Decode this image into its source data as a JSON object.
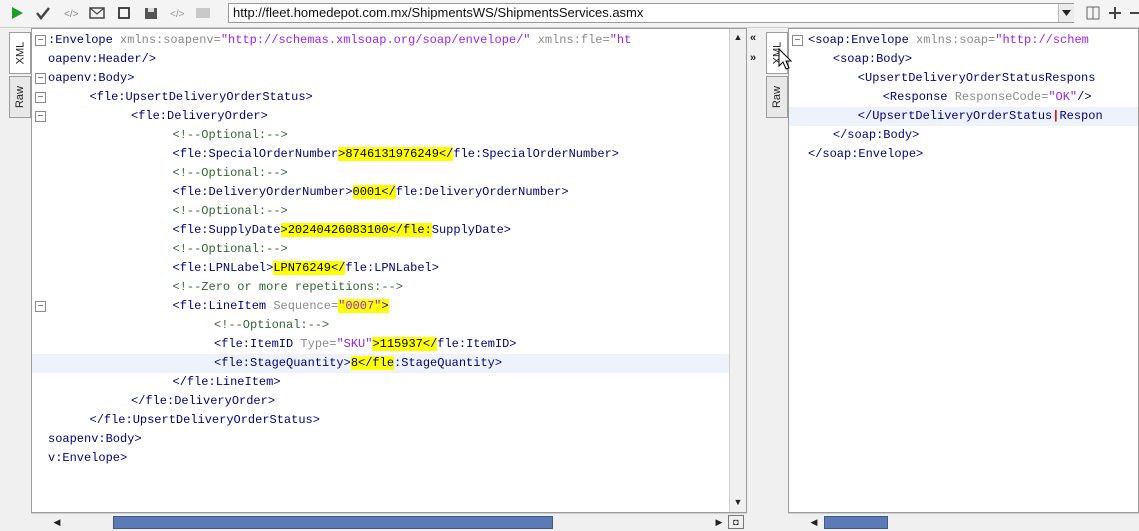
{
  "toolbar": {
    "url": "http://fleet.homedepot.com.mx/ShipmentsWS/ShipmentsServices.asmx",
    "icons": [
      "play-icon",
      "validate-icon",
      "wsdl-icon",
      "envelope-icon",
      "stop-icon",
      "save-icon",
      "settings-icon",
      "blank-icon"
    ],
    "right_icons": [
      "dropdown-icon",
      "split-icon",
      "add-icon",
      "minus-icon"
    ]
  },
  "left": {
    "tabs": [
      "XML",
      "Raw"
    ],
    "lines": [
      {
        "indent": 0,
        "fold": "⊟",
        "parts": [
          [
            "p",
            ":Envelope "
          ],
          [
            "at",
            "xmlns:soapenv="
          ],
          [
            "v",
            "\"http://schemas.xmlsoap.org/soap/envelope/\""
          ],
          [
            "at",
            " xmlns:fle="
          ],
          [
            "v",
            "\"ht"
          ]
        ]
      },
      {
        "indent": 0,
        "fold": "",
        "parts": [
          [
            "p",
            "oapenv:Header/>"
          ]
        ]
      },
      {
        "indent": 0,
        "fold": "⊟",
        "parts": [
          [
            "p",
            "oapenv:Body>"
          ]
        ]
      },
      {
        "indent": 5,
        "fold": "⊟",
        "parts": [
          [
            "p",
            "<fle:UpsertDeliveryOrderStatus>"
          ]
        ]
      },
      {
        "indent": 10,
        "fold": "⊟",
        "parts": [
          [
            "p",
            "<fle:DeliveryOrder>"
          ]
        ]
      },
      {
        "indent": 15,
        "fold": "",
        "parts": [
          [
            "cm",
            "<!--Optional:-->"
          ]
        ]
      },
      {
        "indent": 15,
        "fold": "",
        "parts": [
          [
            "p",
            "<fle:SpecialOrderNumber"
          ],
          [
            "hlp",
            ">"
          ],
          [
            "hl",
            "8746131976249"
          ],
          [
            "hlp",
            "</"
          ],
          [
            "p",
            "fle:SpecialOrderNumber>"
          ]
        ]
      },
      {
        "indent": 15,
        "fold": "",
        "parts": [
          [
            "cm",
            "<!--Optional:-->"
          ]
        ]
      },
      {
        "indent": 15,
        "fold": "",
        "parts": [
          [
            "p",
            "<fle:DeliveryOrderNumber>"
          ],
          [
            "hl",
            "0001"
          ],
          [
            "hlp",
            "</"
          ],
          [
            "p",
            "fle:DeliveryOrderNumber>"
          ]
        ]
      },
      {
        "indent": 15,
        "fold": "",
        "parts": [
          [
            "cm",
            "<!--Optional:-->"
          ]
        ]
      },
      {
        "indent": 15,
        "fold": "",
        "parts": [
          [
            "p",
            "<fle:SupplyDate"
          ],
          [
            "hlp",
            ">"
          ],
          [
            "hl",
            "20240426083100"
          ],
          [
            "hlp",
            "</fle:"
          ],
          [
            "p",
            "SupplyDate>"
          ]
        ]
      },
      {
        "indent": 15,
        "fold": "",
        "parts": [
          [
            "cm",
            "<!--Optional:-->"
          ]
        ]
      },
      {
        "indent": 15,
        "fold": "",
        "parts": [
          [
            "p",
            "<fle:LPNLabel>"
          ],
          [
            "hl",
            "LPN76249"
          ],
          [
            "hlp",
            "</"
          ],
          [
            "p",
            "fle:LPNLabel>"
          ]
        ]
      },
      {
        "indent": 15,
        "fold": "",
        "parts": [
          [
            "cm",
            "<!--Zero or more repetitions:-->"
          ]
        ]
      },
      {
        "indent": 15,
        "fold": "⊟",
        "parts": [
          [
            "p",
            "<fle:LineItem "
          ],
          [
            "at",
            "Sequence="
          ],
          [
            "hlv",
            "\"0007\""
          ],
          [
            "hlp",
            ">"
          ]
        ]
      },
      {
        "indent": 20,
        "fold": "",
        "parts": [
          [
            "cm",
            "<!--Optional:-->"
          ]
        ]
      },
      {
        "indent": 20,
        "fold": "",
        "parts": [
          [
            "p",
            "<fle:ItemID "
          ],
          [
            "at",
            "Type="
          ],
          [
            "v",
            "\"SKU\""
          ],
          [
            "hlp",
            ">"
          ],
          [
            "hl",
            "115937"
          ],
          [
            "hlp",
            "</"
          ],
          [
            "p",
            "fle:ItemID>"
          ]
        ]
      },
      {
        "indent": 20,
        "fold": "",
        "current": true,
        "parts": [
          [
            "p",
            "<fle:StageQuantity>"
          ],
          [
            "hl",
            "8"
          ],
          [
            "hlp",
            "</fle"
          ],
          [
            "p",
            ":StageQuantity>"
          ]
        ]
      },
      {
        "indent": 15,
        "fold": "",
        "parts": [
          [
            "p",
            "</fle:LineItem>"
          ]
        ]
      },
      {
        "indent": 10,
        "fold": "",
        "parts": [
          [
            "p",
            "</fle:DeliveryOrder>"
          ]
        ]
      },
      {
        "indent": 5,
        "fold": "",
        "parts": [
          [
            "p",
            "</fle:UpsertDeliveryOrderStatus>"
          ]
        ]
      },
      {
        "indent": 0,
        "fold": "",
        "parts": [
          [
            "p",
            "soapenv:Body>"
          ]
        ]
      },
      {
        "indent": 0,
        "fold": "",
        "parts": [
          [
            "p",
            "v:Envelope>"
          ]
        ]
      }
    ]
  },
  "right": {
    "tabs": [
      "XML",
      "Raw"
    ],
    "lines": [
      {
        "indent": 0,
        "fold": "⊟",
        "parts": [
          [
            "p",
            "<soap:Envelope "
          ],
          [
            "at",
            "xmlns:soap="
          ],
          [
            "v",
            "\"http://schem"
          ]
        ]
      },
      {
        "indent": 3,
        "fold": "",
        "parts": [
          [
            "p",
            "<soap:Body>"
          ]
        ]
      },
      {
        "indent": 6,
        "fold": "",
        "parts": [
          [
            "p",
            "<UpsertDeliveryOrderStatusRespons"
          ]
        ]
      },
      {
        "indent": 9,
        "fold": "",
        "parts": [
          [
            "p",
            "<Response "
          ],
          [
            "at",
            "ResponseCode="
          ],
          [
            "v",
            "\"OK\""
          ],
          [
            "p",
            "/>"
          ]
        ]
      },
      {
        "indent": 6,
        "fold": "",
        "current": true,
        "parts": [
          [
            "p",
            "</UpsertDeliveryOrderStatus"
          ],
          [
            "caret",
            "|"
          ],
          [
            "p",
            "Respon"
          ]
        ]
      },
      {
        "indent": 3,
        "fold": "",
        "parts": [
          [
            "p",
            "</soap:Body>"
          ]
        ]
      },
      {
        "indent": 0,
        "fold": "",
        "parts": [
          [
            "p",
            "</soap:Envelope>"
          ]
        ]
      }
    ]
  },
  "colors": {
    "tag": "#000080",
    "attr": "#8a8a8a",
    "value": "#a020f0",
    "comment": "#336633",
    "highlight": "#ffff00",
    "caret": "#e00000"
  }
}
